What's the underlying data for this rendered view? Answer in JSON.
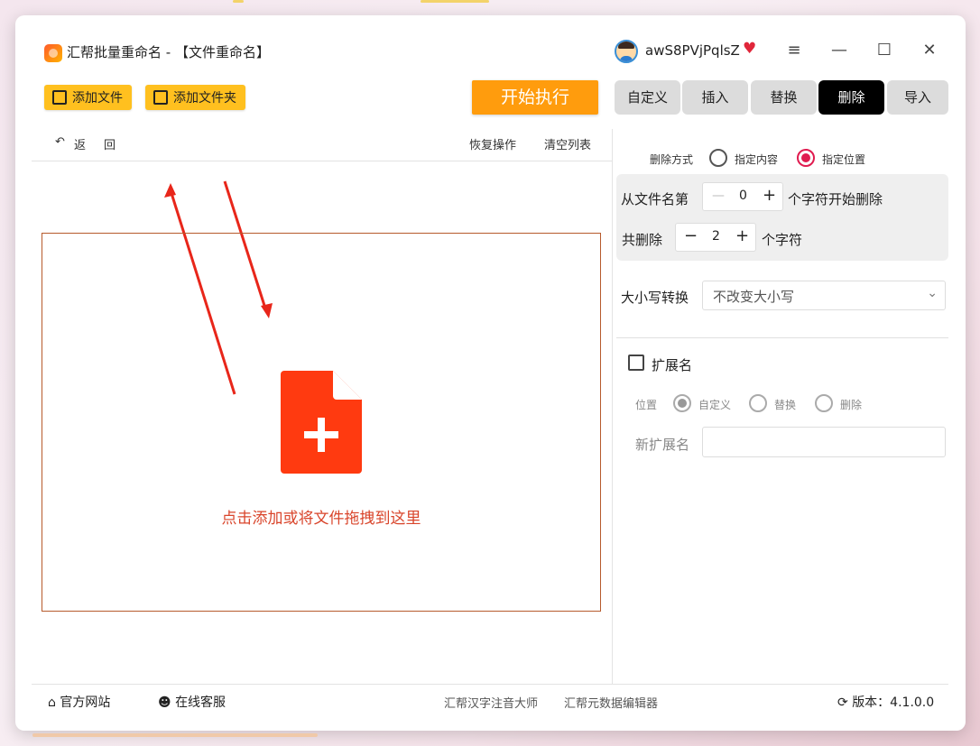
{
  "window": {
    "title": "汇帮批量重命名 - 【文件重命名】",
    "username": "awS8PVjPqlsZ",
    "controls": {
      "menu": "≡",
      "minimize": "—",
      "maximize": "☐",
      "close": "✕"
    }
  },
  "toolbar": {
    "add_file": "添加文件",
    "add_folder": "添加文件夹",
    "start": "开始执行",
    "tabs": [
      {
        "label": "自定义",
        "active": false
      },
      {
        "label": "插入",
        "active": false
      },
      {
        "label": "替换",
        "active": false
      },
      {
        "label": "删除",
        "active": true
      },
      {
        "label": "导入",
        "active": false
      }
    ]
  },
  "file_list": {
    "back": "返回",
    "restore": "恢复操作",
    "clear": "清空列表",
    "drop_hint": "点击添加或将文件拖拽到这里"
  },
  "delete_panel": {
    "mode_label": "删除方式",
    "mode_options": [
      "指定内容",
      "指定位置"
    ],
    "mode_selected": "指定位置",
    "from_label": "从文件名第",
    "from_value": "0",
    "from_suffix": "个字符开始删除",
    "count_label": "共删除",
    "count_value": "2",
    "count_suffix": "个字符",
    "case_label": "大小写转换",
    "case_value": "不改变大小写",
    "ext_label": "扩展名",
    "ext_checked": false,
    "position_label": "位置",
    "position_options": [
      "自定义",
      "替换",
      "删除"
    ],
    "position_selected": "自定义",
    "new_ext_label": "新扩展名",
    "new_ext_value": ""
  },
  "footer": {
    "website": "官方网站",
    "support": "在线客服",
    "link1": "汇帮汉字注音大师",
    "link2": "汇帮元数据编辑器",
    "version": "版本：4.1.0.0"
  },
  "colors": {
    "accent_yellow": "#ffc01f",
    "start_orange": "#ff9c0d",
    "drop_red": "#d9452b",
    "file_icon": "#ff3a10",
    "radio_pink": "#e01b4f"
  }
}
